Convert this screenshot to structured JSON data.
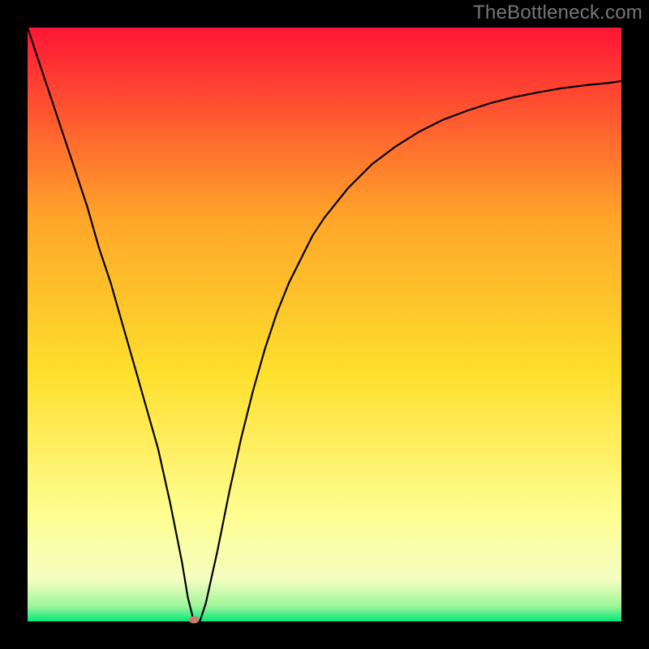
{
  "watermark": "TheBottleneck.com",
  "colors": {
    "gradient_top": "#fe1535",
    "gradient_upper_mid": "#ffa529",
    "gradient_mid": "#fedf2c",
    "gradient_lower": "#fefe91",
    "gradient_near_bottom": "#f4fec0",
    "gradient_edge": "#9bf598",
    "gradient_bottom": "#02e67a",
    "dot": "#c87e6c"
  },
  "chart_data": {
    "type": "line",
    "title": "",
    "xlabel": "",
    "ylabel": "",
    "xlim": [
      0,
      100
    ],
    "ylim": [
      0,
      100
    ],
    "grid": false,
    "legend": false,
    "annotations": [],
    "series": [
      {
        "name": "bottleneck-curve",
        "x": [
          0,
          2,
          4,
          6,
          8,
          10,
          12,
          14,
          16,
          18,
          20,
          22,
          24,
          26,
          27,
          28,
          29,
          30,
          32,
          34,
          36,
          38,
          40,
          42,
          44,
          46,
          48,
          50,
          54,
          58,
          62,
          66,
          70,
          74,
          78,
          82,
          86,
          90,
          94,
          98,
          100
        ],
        "y": [
          100,
          94,
          88,
          82,
          76,
          70,
          63,
          57,
          50,
          43,
          36,
          29,
          20,
          10,
          4,
          0,
          0,
          3,
          12,
          22,
          31,
          39,
          46,
          52,
          57,
          61,
          65,
          68,
          73,
          77,
          80,
          82.5,
          84.5,
          86,
          87.3,
          88.3,
          89.1,
          89.8,
          90.3,
          90.7,
          91
        ]
      }
    ],
    "optimum": {
      "x": 28,
      "y": 0
    }
  }
}
